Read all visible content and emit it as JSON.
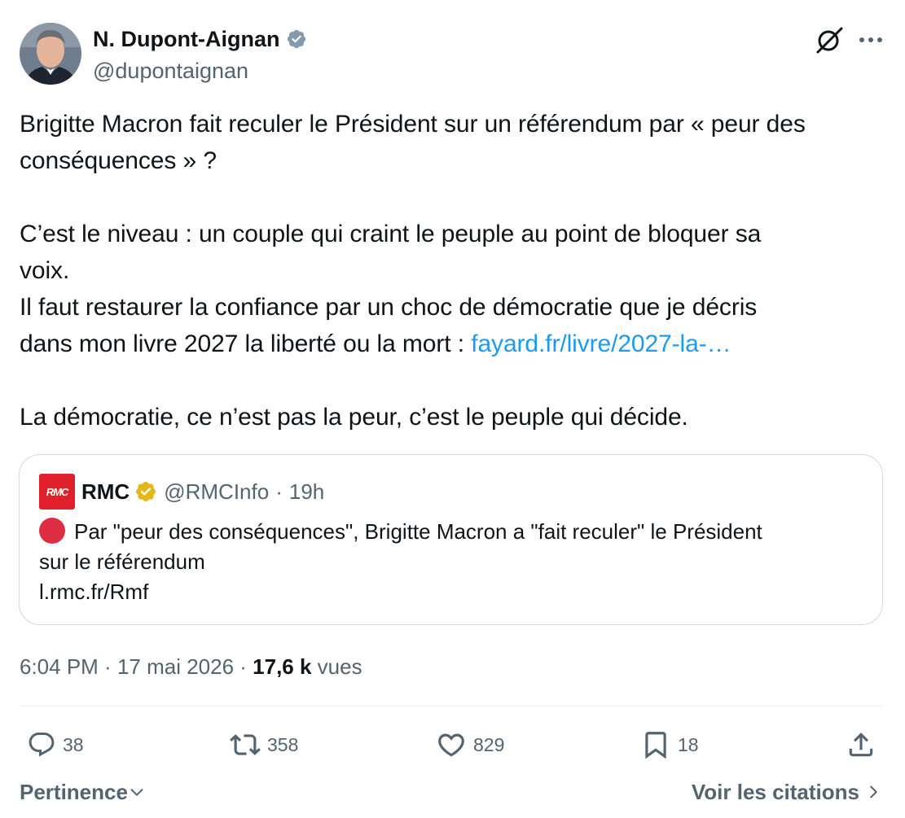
{
  "author": {
    "name": "N. Dupont-Aignan",
    "handle": "@dupontaignan",
    "verified": true
  },
  "tweet": {
    "paragraphs": [
      "Brigitte Macron fait reculer le Président sur un référendum par « peur des",
      "conséquences » ?",
      "C’est le niveau : un couple qui craint le peuple au point de bloquer sa",
      "voix.",
      "Il faut restaurer la confiance par un choc de démocratie que je décris",
      "dans mon livre 2027 la liberté ou la mort : ",
      "La démocratie, ce n’est pas la peur, c’est le peuple qui décide."
    ],
    "link_text": "fayard.fr/livre/2027-la-…"
  },
  "quote": {
    "logo_text": "RMC",
    "name": "RMC",
    "handle": "@RMCInfo",
    "separator": "·",
    "time": "19h",
    "text_line1": "Par \"peur des conséquences\", Brigitte Macron a \"fait reculer\" le Président",
    "text_line2": "sur le référendum",
    "link": "l.rmc.fr/Rmf"
  },
  "meta": {
    "time": "6:04 PM",
    "sep1": " · ",
    "date": "17 mai 2026",
    "sep2": " · ",
    "views_count": "17,6 k",
    "views_label": " vues"
  },
  "actions": {
    "replies": "38",
    "reposts": "358",
    "likes": "829",
    "bookmarks": "18"
  },
  "footer": {
    "sort_label": "Pertinence",
    "quotes_label": "Voir les citations"
  },
  "colors": {
    "link": "#1d9bf0",
    "secondary_text": "#536471",
    "primary_text": "#0f1419",
    "border": "#cfd9de",
    "rmc_red": "#e0202b",
    "gold_badge": "#e2b719"
  }
}
